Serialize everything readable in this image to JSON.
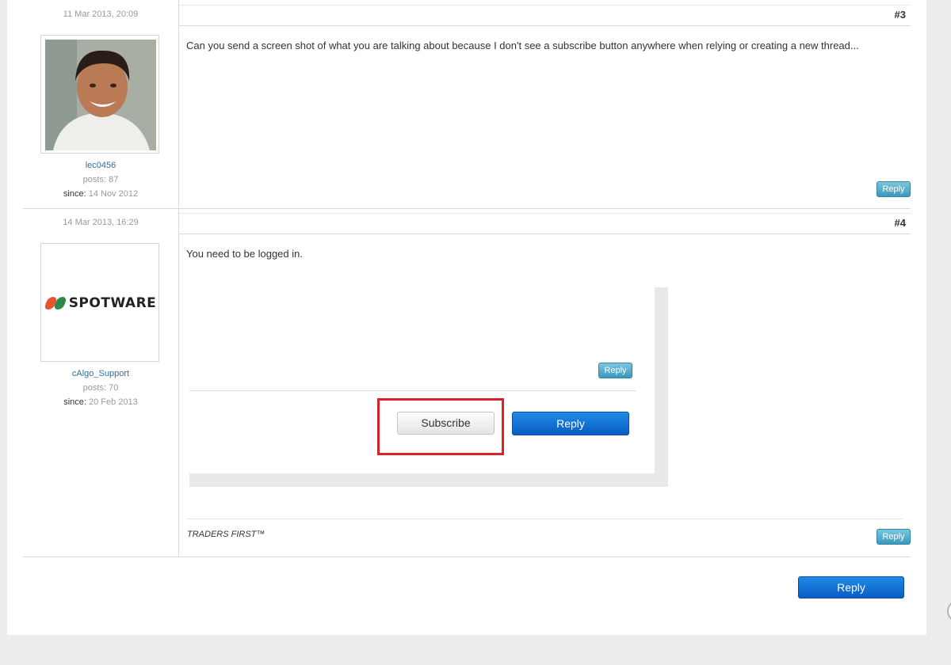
{
  "posts": [
    {
      "date": "11 Mar 2013, 20:09",
      "number": "#3",
      "username": "lec0456",
      "posts_label": "posts: 87",
      "since_label": "since:",
      "since_value": "14 Nov 2012",
      "text": "Can you send a screen shot of what you are talking about because I don't see a subscribe button anywhere when relying or creating a new thread...",
      "reply_label": "Reply"
    },
    {
      "date": "14 Mar 2013, 16:29",
      "number": "#4",
      "username": "cAlgo_Support",
      "logo_text": "SPOTWARE",
      "posts_label": "posts: 70",
      "since_label": "since:",
      "since_value": "20 Feb 2013",
      "text": "You need to be logged in.",
      "screenshot": {
        "small_reply_label": "Reply",
        "subscribe_label": "Subscribe",
        "big_reply_label": "Reply",
        "highlight_color": "#d8232a"
      },
      "signature": "TRADERS FIRST™",
      "reply_label": "Reply"
    }
  ],
  "footer": {
    "reply_label": "Reply"
  },
  "colors": {
    "link": "#2f6ea5",
    "small_button": "#3b98bc",
    "primary_button": "#0a5cc4",
    "background": "#ececec"
  }
}
